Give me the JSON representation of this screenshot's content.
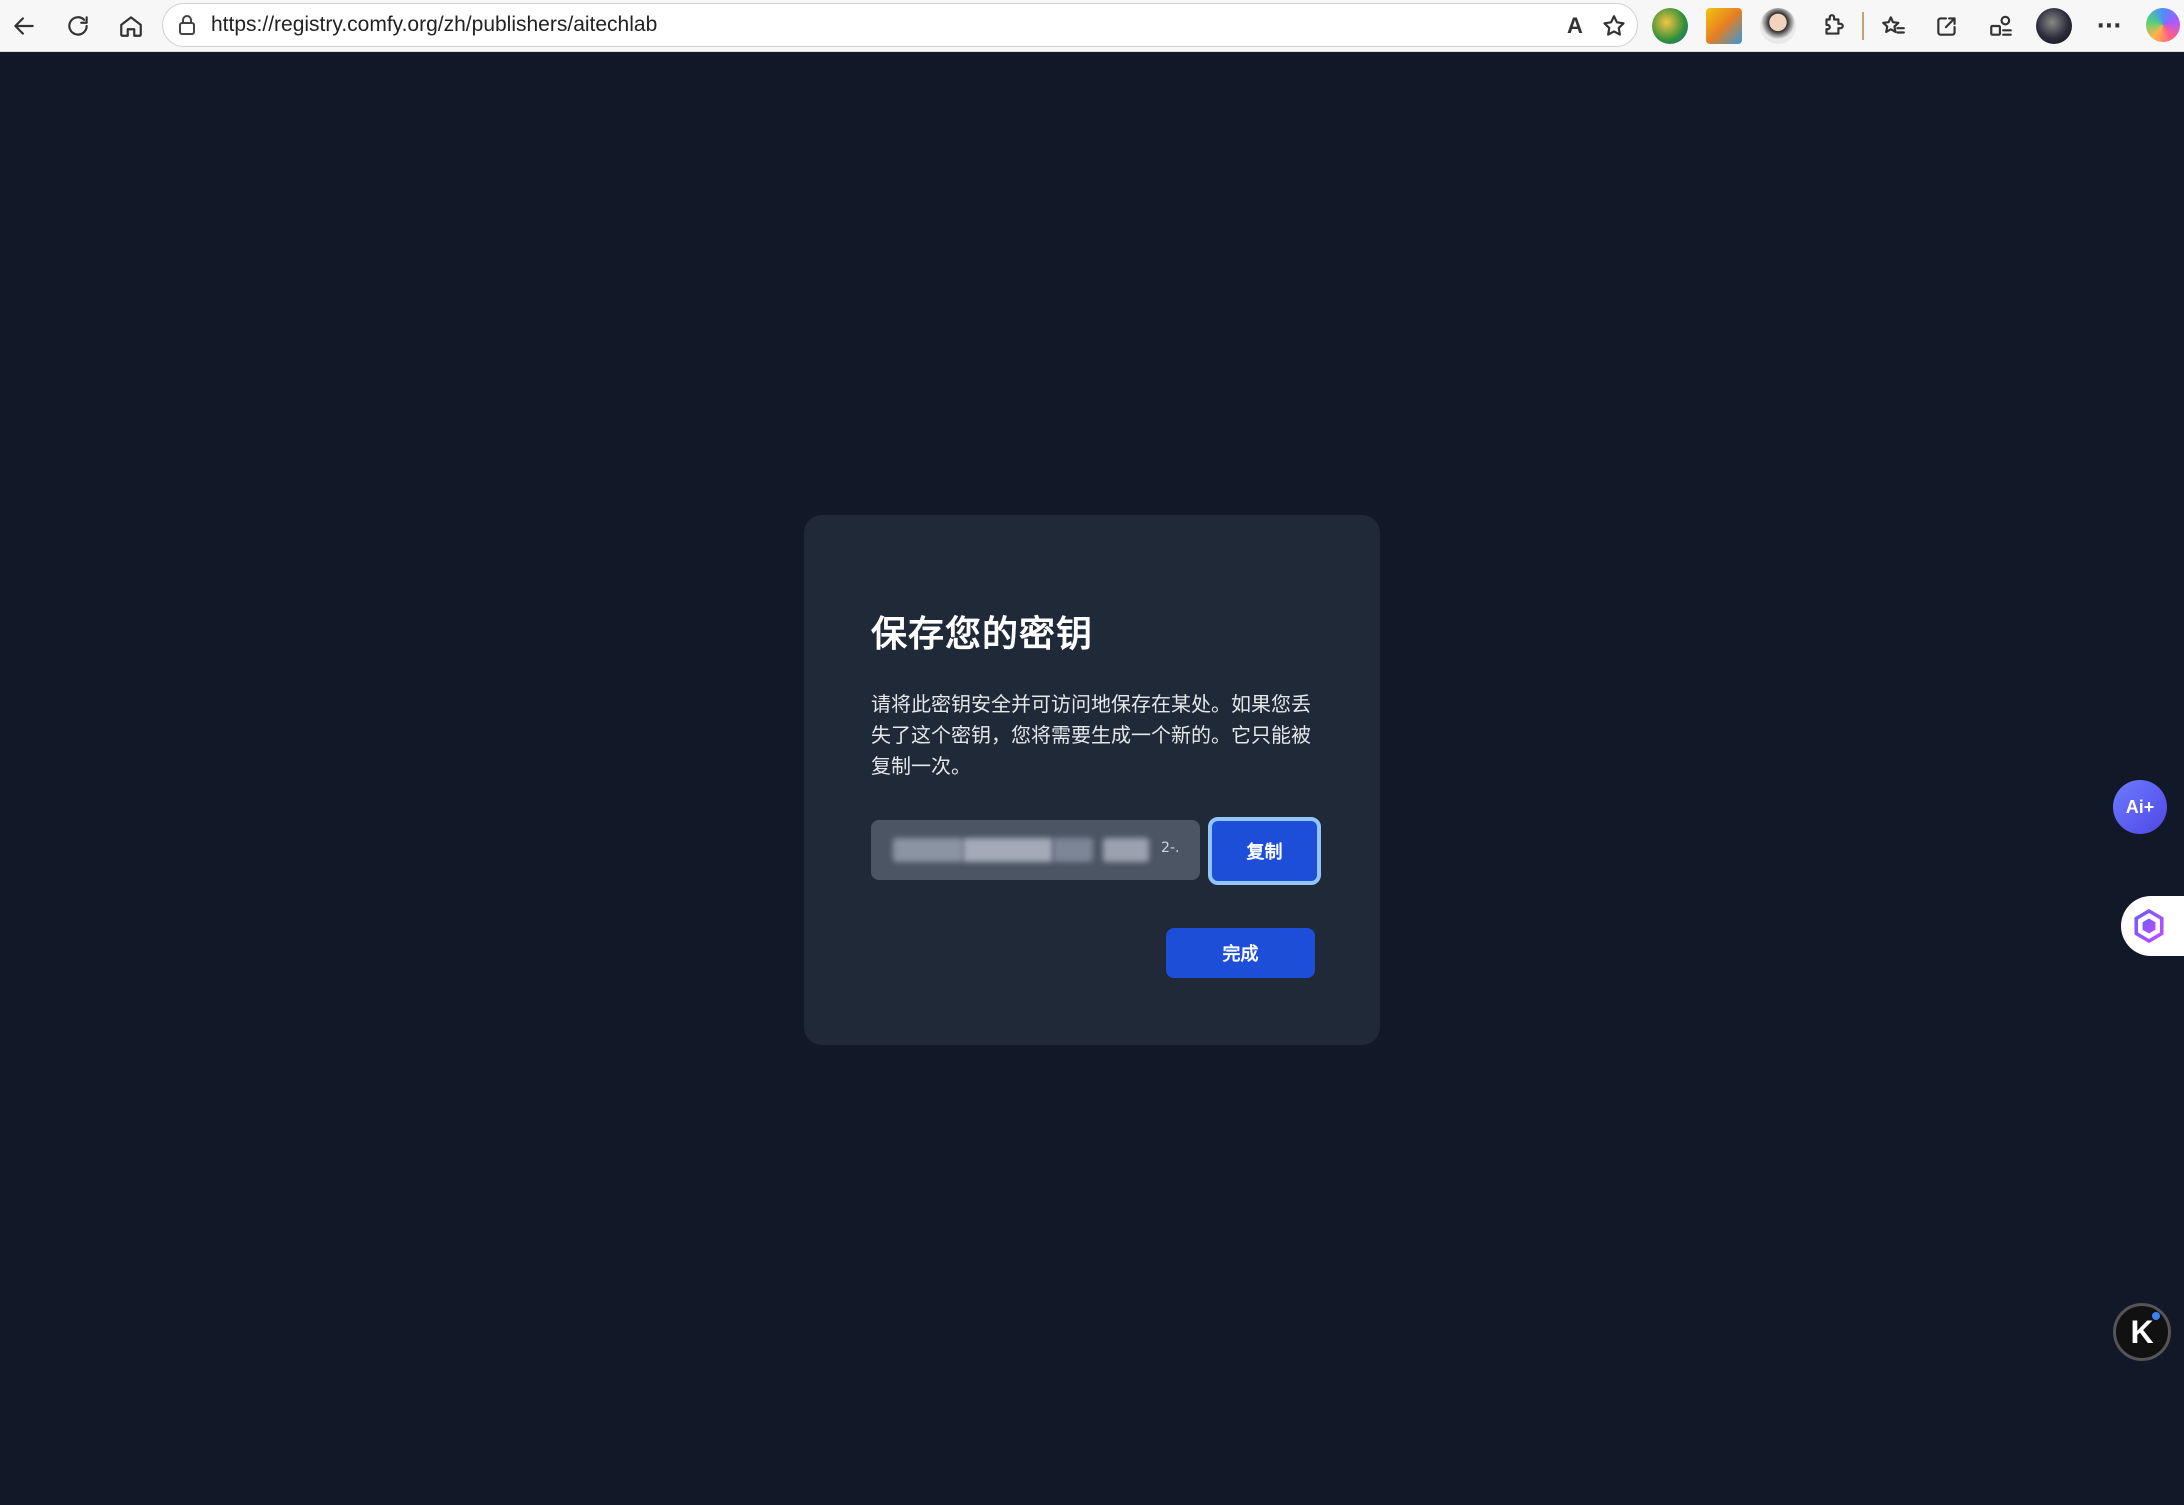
{
  "browser": {
    "url": "https://registry.comfy.org/zh/publishers/aitechlab",
    "read_aloud_label": "A",
    "more_label": "···"
  },
  "modal": {
    "title": "保存您的密钥",
    "description": "请将此密钥安全并可访问地保存在某处。如果您丢失了这个密钥，您将需要生成一个新的。它只能被复制一次。",
    "key_suffix": "2-.",
    "copy_label": "复制",
    "done_label": "完成"
  },
  "widgets": {
    "ai_label": "Ai+",
    "k_label": "K"
  },
  "colors": {
    "page_bg": "#111827",
    "modal_bg": "#1f2937",
    "primary": "#1d4ed8",
    "focus_ring": "#93c5fd"
  }
}
